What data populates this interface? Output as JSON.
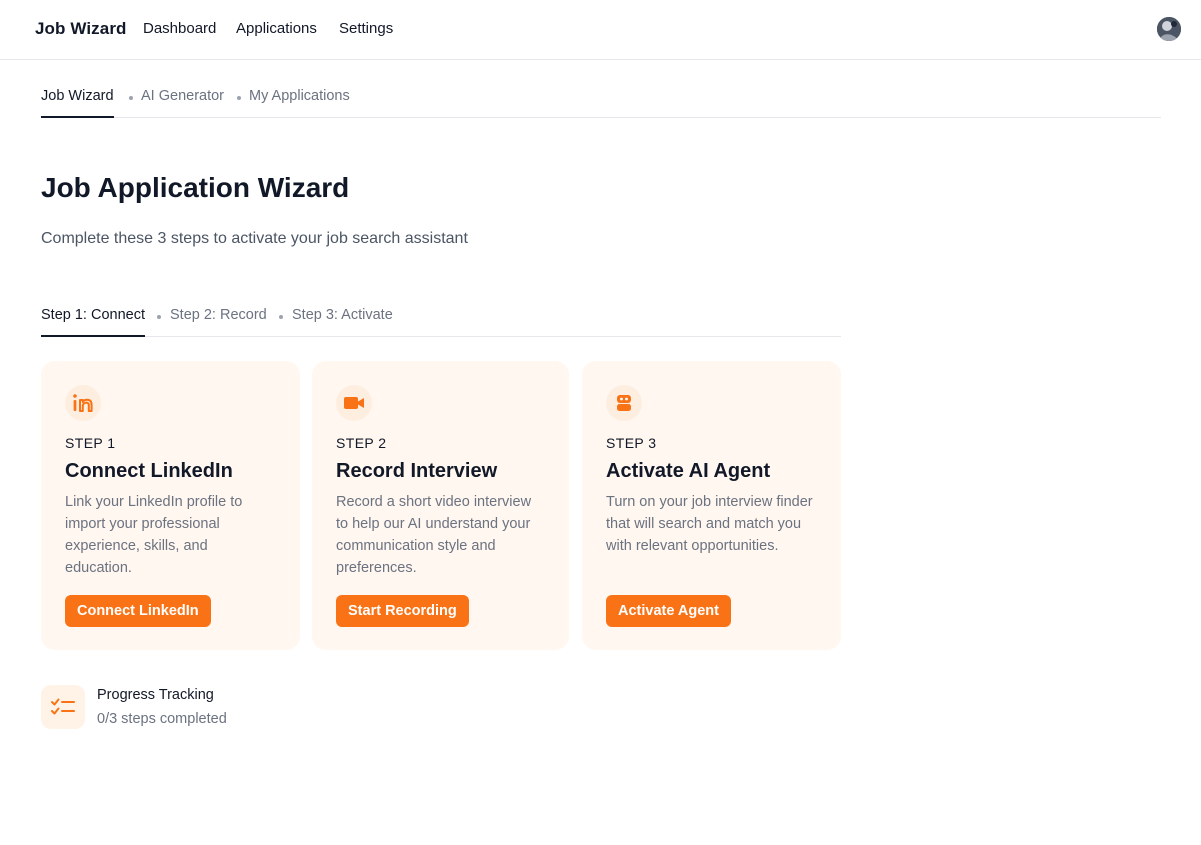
{
  "topbar": {
    "brand": "Job Wizard",
    "nav": [
      "Dashboard",
      "Applications",
      "Settings"
    ]
  },
  "subtabs": {
    "items": [
      "Job Wizard",
      "AI Generator",
      "My Applications"
    ],
    "active": "Job Wizard"
  },
  "page": {
    "title": "Job Application Wizard",
    "subtitle": "Complete these 3 steps to activate your job search assistant"
  },
  "steptabs": {
    "items": [
      "Step 1: Connect",
      "Step 2: Record",
      "Step 3: Activate"
    ],
    "active": "Step 1: Connect"
  },
  "cards": [
    {
      "icon": "linkedin-icon",
      "step": "STEP 1",
      "title": "Connect LinkedIn",
      "description": "Link your LinkedIn profile to import your professional experience, skills, and education.",
      "button": "Connect LinkedIn"
    },
    {
      "icon": "video-camera-icon",
      "step": "STEP 2",
      "title": "Record Interview",
      "description": "Record a short video interview to help our AI understand your communication style and preferences.",
      "button": "Start Recording"
    },
    {
      "icon": "robot-icon",
      "step": "STEP 3",
      "title": "Activate AI Agent",
      "description": "Turn on your job interview finder that will search and match you with relevant opportunities.",
      "button": "Activate Agent"
    }
  ],
  "progress": {
    "icon": "checklist-icon",
    "title": "Progress Tracking",
    "status": "0/3 steps completed",
    "completed": 0,
    "total": 3
  },
  "colors": {
    "accent": "#f97316",
    "card_bg": "#fff7f0",
    "text": "#111827",
    "muted": "#6b7280"
  }
}
